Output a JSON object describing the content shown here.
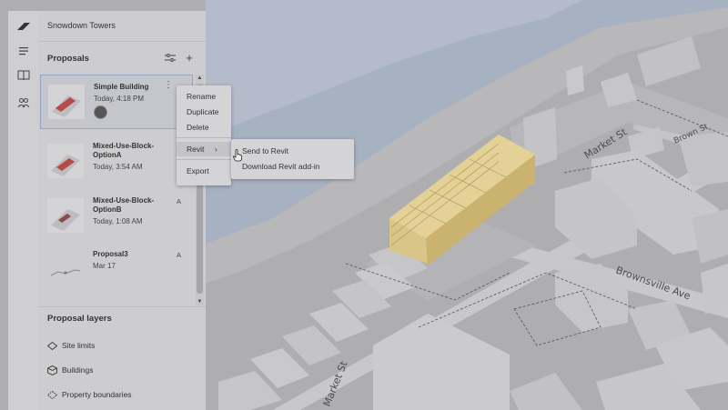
{
  "project": {
    "title": "Snowdown Towers"
  },
  "proposals": {
    "title": "Proposals",
    "items": [
      {
        "name": "Simple Building",
        "date": "Today, 4:18 PM",
        "badge": ""
      },
      {
        "name": "Mixed-Use-Block-OptionA",
        "date": "Today, 3:54 AM",
        "badge": "A"
      },
      {
        "name": "Mixed-Use-Block-OptionB",
        "date": "Today, 1:08 AM",
        "badge": "A"
      },
      {
        "name": "Proposal3",
        "date": "Mar 17",
        "badge": "A"
      }
    ]
  },
  "layers": {
    "title": "Proposal layers",
    "items": [
      {
        "label": "Site limits",
        "icon": "site-limits-icon"
      },
      {
        "label": "Buildings",
        "icon": "buildings-icon"
      },
      {
        "label": "Property boundaries",
        "icon": "property-boundaries-icon"
      }
    ]
  },
  "context_menu": {
    "items": [
      "Rename",
      "Duplicate",
      "Delete",
      "Revit",
      "Export"
    ]
  },
  "submenu": {
    "items": [
      "Send to Revit",
      "Download Revit add-in"
    ]
  },
  "map": {
    "streets": [
      "Market St",
      "Brownsville Ave",
      "Market St",
      "Brown St"
    ]
  },
  "colors": {
    "accent_selected_border": "#8fa6c6",
    "building_highlight": "#d7c382",
    "water": "#a7b4c6"
  }
}
